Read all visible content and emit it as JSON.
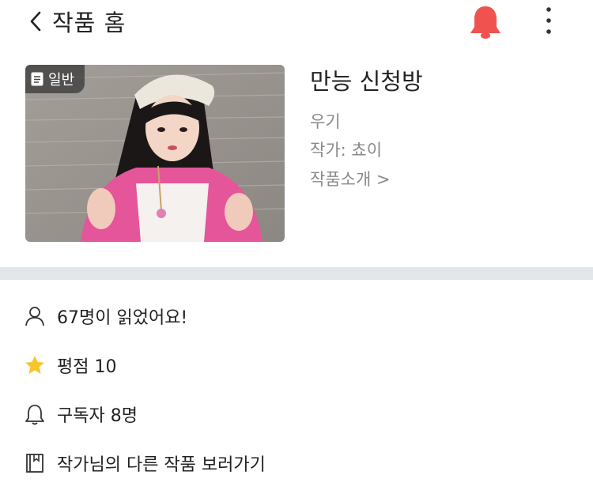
{
  "header": {
    "title": "작품 홈"
  },
  "work": {
    "badge_label": "일반",
    "title": "만능 신청방",
    "genre": "우기",
    "author": "작가: 쵸이",
    "intro_link": "작품소개 >"
  },
  "stats": {
    "readers": "67명이 읽었어요!",
    "rating": "평점 10",
    "subscribers": "구독자 8명",
    "other_works": "작가님의 다른 작품 보러가기"
  },
  "colors": {
    "bell_accent": "#f0534f",
    "star": "#f7c52b",
    "divider": "#e3e6e9",
    "meta_text": "#8a8a8a"
  },
  "icons": [
    "back-arrow-icon",
    "bell-icon",
    "more-vertical-icon",
    "document-icon",
    "person-icon",
    "star-icon",
    "bell-outline-icon",
    "book-icon"
  ]
}
